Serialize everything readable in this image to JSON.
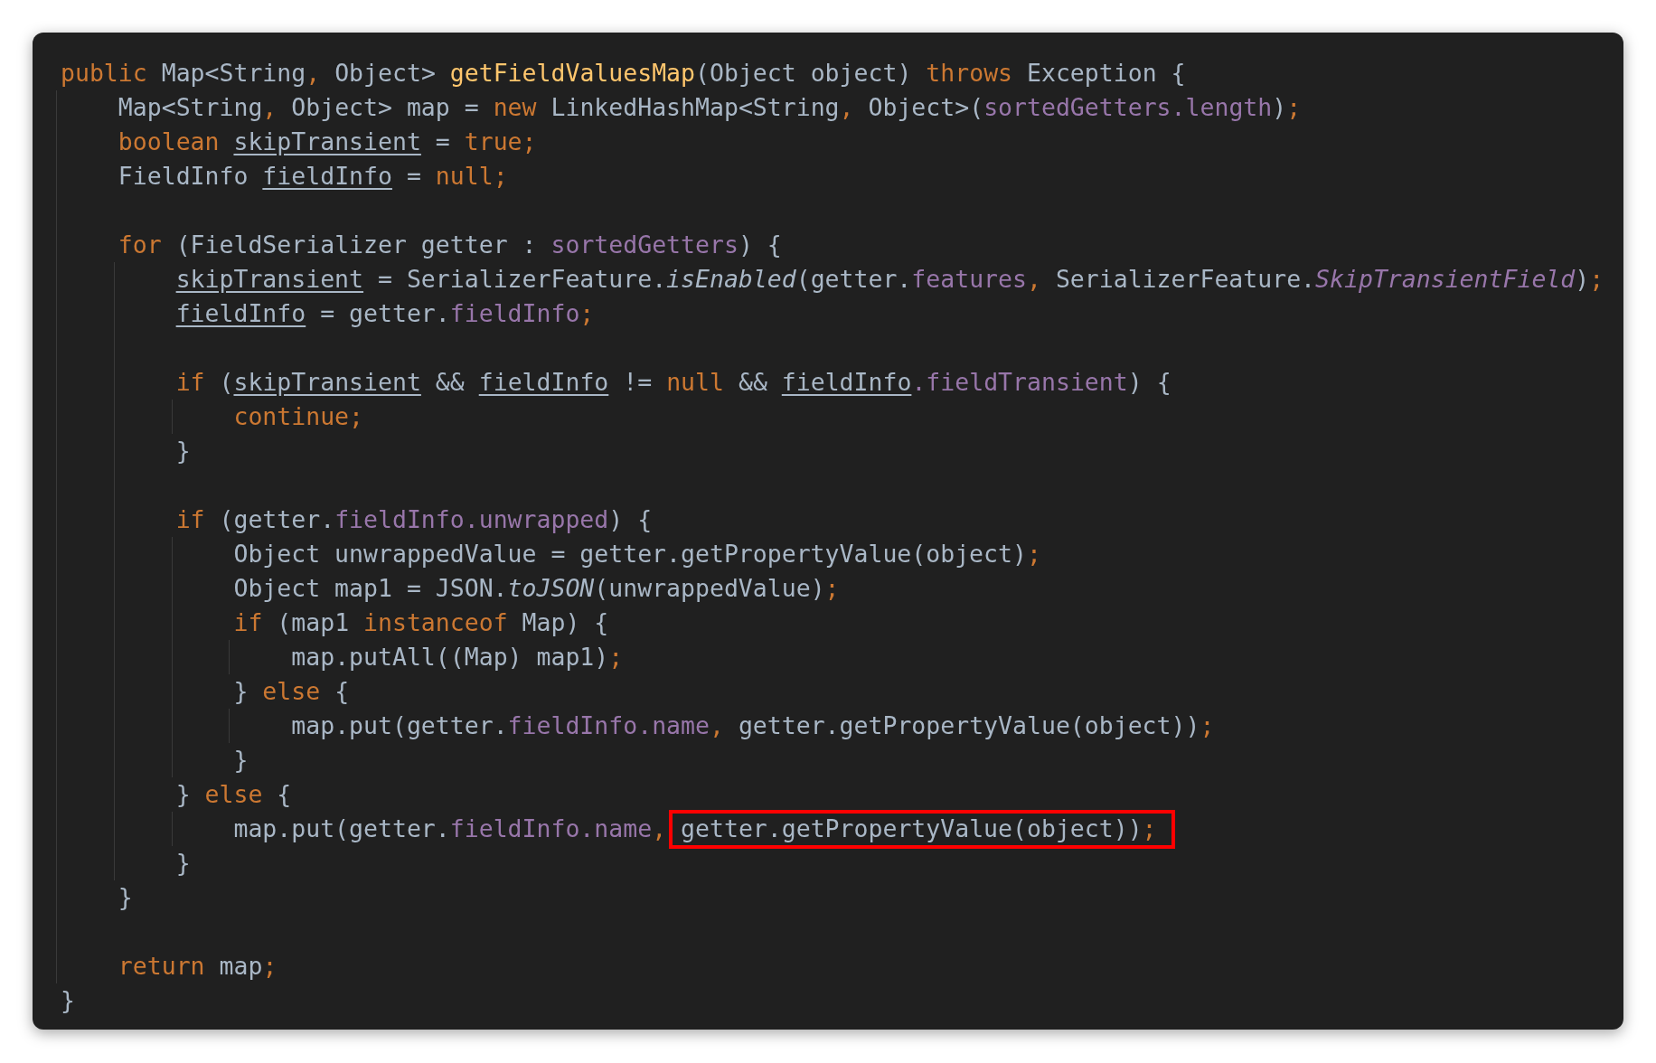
{
  "code_lines": [
    {
      "kind": "code",
      "tokens": [
        {
          "kind": "kw",
          "text": "public"
        },
        {
          "kind": "plain",
          "text": " Map<String"
        },
        {
          "kind": "kw",
          "text": ","
        },
        {
          "kind": "plain",
          "text": " Object> "
        },
        {
          "kind": "decl",
          "text": "getFieldValuesMap"
        },
        {
          "kind": "plain",
          "text": "(Object object) "
        },
        {
          "kind": "kw",
          "text": "throws"
        },
        {
          "kind": "plain",
          "text": " Exception {"
        }
      ],
      "children": [
        {
          "kind": "code",
          "tokens": [
            {
              "kind": "plain",
              "text": "Map<String"
            },
            {
              "kind": "kw",
              "text": ","
            },
            {
              "kind": "plain",
              "text": " Object> map = "
            },
            {
              "kind": "kw",
              "text": "new"
            },
            {
              "kind": "plain",
              "text": " LinkedHashMap<String"
            },
            {
              "kind": "kw",
              "text": ","
            },
            {
              "kind": "plain",
              "text": " Object>("
            },
            {
              "kind": "field",
              "text": "sortedGetters"
            },
            {
              "kind": "field",
              "text": ".length"
            },
            {
              "kind": "plain",
              "text": ")"
            },
            {
              "kind": "kw",
              "text": ";"
            }
          ]
        },
        {
          "kind": "code",
          "tokens": [
            {
              "kind": "kw",
              "text": "boolean "
            },
            {
              "kind": "var",
              "text": "skipTransient"
            },
            {
              "kind": "plain",
              "text": " = "
            },
            {
              "kind": "kw",
              "text": "true;"
            }
          ]
        },
        {
          "kind": "code",
          "tokens": [
            {
              "kind": "plain",
              "text": "FieldInfo "
            },
            {
              "kind": "var",
              "text": "fieldInfo"
            },
            {
              "kind": "plain",
              "text": " = "
            },
            {
              "kind": "kw",
              "text": "null;"
            }
          ]
        },
        {
          "kind": "blank"
        },
        {
          "kind": "code",
          "tokens": [
            {
              "kind": "kw",
              "text": "for"
            },
            {
              "kind": "plain",
              "text": " (FieldSerializer getter : "
            },
            {
              "kind": "field",
              "text": "sortedGetters"
            },
            {
              "kind": "plain",
              "text": ") {"
            }
          ],
          "children": [
            {
              "kind": "code",
              "tokens": [
                {
                  "kind": "var",
                  "text": "skipTransient"
                },
                {
                  "kind": "plain",
                  "text": " = SerializerFeature."
                },
                {
                  "kind": "imethod",
                  "text": "isEnabled"
                },
                {
                  "kind": "plain",
                  "text": "(getter."
                },
                {
                  "kind": "field",
                  "text": "features"
                },
                {
                  "kind": "kw",
                  "text": ","
                },
                {
                  "kind": "plain",
                  "text": " SerializerFeature."
                },
                {
                  "kind": "ifield",
                  "text": "SkipTransientField"
                },
                {
                  "kind": "plain",
                  "text": ")"
                },
                {
                  "kind": "kw",
                  "text": ";"
                }
              ]
            },
            {
              "kind": "code",
              "tokens": [
                {
                  "kind": "var",
                  "text": "fieldInfo"
                },
                {
                  "kind": "plain",
                  "text": " = getter."
                },
                {
                  "kind": "field",
                  "text": "fieldInfo"
                },
                {
                  "kind": "kw",
                  "text": ";"
                }
              ]
            },
            {
              "kind": "blank"
            },
            {
              "kind": "code",
              "tokens": [
                {
                  "kind": "kw",
                  "text": "if"
                },
                {
                  "kind": "plain",
                  "text": " ("
                },
                {
                  "kind": "var",
                  "text": "skipTransient"
                },
                {
                  "kind": "plain",
                  "text": " && "
                },
                {
                  "kind": "var",
                  "text": "fieldInfo"
                },
                {
                  "kind": "plain",
                  "text": " != "
                },
                {
                  "kind": "kw",
                  "text": "null"
                },
                {
                  "kind": "plain",
                  "text": " && "
                },
                {
                  "kind": "var",
                  "text": "fieldInfo"
                },
                {
                  "kind": "field",
                  "text": ".fieldTransient"
                },
                {
                  "kind": "plain",
                  "text": ") {"
                }
              ],
              "children": [
                {
                  "kind": "code",
                  "tokens": [
                    {
                      "kind": "kw",
                      "text": "continue;"
                    }
                  ]
                }
              ]
            },
            {
              "kind": "code",
              "tokens": [
                {
                  "kind": "plain",
                  "text": "}"
                }
              ]
            },
            {
              "kind": "blank"
            },
            {
              "kind": "code",
              "tokens": [
                {
                  "kind": "kw",
                  "text": "if"
                },
                {
                  "kind": "plain",
                  "text": " (getter."
                },
                {
                  "kind": "field",
                  "text": "fieldInfo"
                },
                {
                  "kind": "field",
                  "text": ".unwrapped"
                },
                {
                  "kind": "plain",
                  "text": ") {"
                }
              ],
              "children": [
                {
                  "kind": "code",
                  "tokens": [
                    {
                      "kind": "plain",
                      "text": "Object unwrappedValue = getter.getPropertyValue(object)"
                    },
                    {
                      "kind": "kw",
                      "text": ";"
                    }
                  ]
                },
                {
                  "kind": "code",
                  "tokens": [
                    {
                      "kind": "plain",
                      "text": "Object map1 = JSON."
                    },
                    {
                      "kind": "imethod",
                      "text": "toJSON"
                    },
                    {
                      "kind": "plain",
                      "text": "(unwrappedValue)"
                    },
                    {
                      "kind": "kw",
                      "text": ";"
                    }
                  ]
                },
                {
                  "kind": "code",
                  "tokens": [
                    {
                      "kind": "kw",
                      "text": "if"
                    },
                    {
                      "kind": "plain",
                      "text": " (map1 "
                    },
                    {
                      "kind": "kw",
                      "text": "instanceof"
                    },
                    {
                      "kind": "plain",
                      "text": " Map) {"
                    }
                  ],
                  "children": [
                    {
                      "kind": "code",
                      "tokens": [
                        {
                          "kind": "plain",
                          "text": "map.putAll((Map) map1)"
                        },
                        {
                          "kind": "kw",
                          "text": ";"
                        }
                      ]
                    }
                  ]
                },
                {
                  "kind": "code",
                  "tokens": [
                    {
                      "kind": "plain",
                      "text": "} "
                    },
                    {
                      "kind": "kw",
                      "text": "else"
                    },
                    {
                      "kind": "plain",
                      "text": " {"
                    }
                  ],
                  "children": [
                    {
                      "kind": "code",
                      "tokens": [
                        {
                          "kind": "plain",
                          "text": "map.put(getter."
                        },
                        {
                          "kind": "field",
                          "text": "fieldInfo"
                        },
                        {
                          "kind": "field",
                          "text": ".name"
                        },
                        {
                          "kind": "kw",
                          "text": ","
                        },
                        {
                          "kind": "plain",
                          "text": " getter.getPropertyValue(object))"
                        },
                        {
                          "kind": "kw",
                          "text": ";"
                        }
                      ]
                    }
                  ]
                },
                {
                  "kind": "code",
                  "tokens": [
                    {
                      "kind": "plain",
                      "text": "}"
                    }
                  ]
                }
              ]
            },
            {
              "kind": "code",
              "tokens": [
                {
                  "kind": "plain",
                  "text": "} "
                },
                {
                  "kind": "kw",
                  "text": "else"
                },
                {
                  "kind": "plain",
                  "text": " {"
                }
              ],
              "children": [
                {
                  "kind": "code",
                  "tokens": [
                    {
                      "kind": "plain",
                      "text": "map.put(getter."
                    },
                    {
                      "kind": "field",
                      "text": "fieldInfo"
                    },
                    {
                      "kind": "field",
                      "text": ".name"
                    },
                    {
                      "kind": "kw",
                      "text": ", "
                    },
                    {
                      "kind": "boxed",
                      "parts": [
                        {
                          "kind": "plain",
                          "text": "getter.getPropertyValue(object))"
                        },
                        {
                          "kind": "kw",
                          "text": ";"
                        }
                      ]
                    }
                  ]
                }
              ]
            },
            {
              "kind": "code",
              "tokens": [
                {
                  "kind": "plain",
                  "text": "}"
                }
              ]
            }
          ]
        },
        {
          "kind": "code",
          "tokens": [
            {
              "kind": "plain",
              "text": "}"
            }
          ]
        },
        {
          "kind": "blank"
        },
        {
          "kind": "code",
          "tokens": [
            {
              "kind": "kw",
              "text": "return"
            },
            {
              "kind": "plain",
              "text": " map"
            },
            {
              "kind": "kw",
              "text": ";"
            }
          ]
        }
      ]
    },
    {
      "kind": "code",
      "tokens": [
        {
          "kind": "plain",
          "text": "}"
        }
      ]
    }
  ]
}
